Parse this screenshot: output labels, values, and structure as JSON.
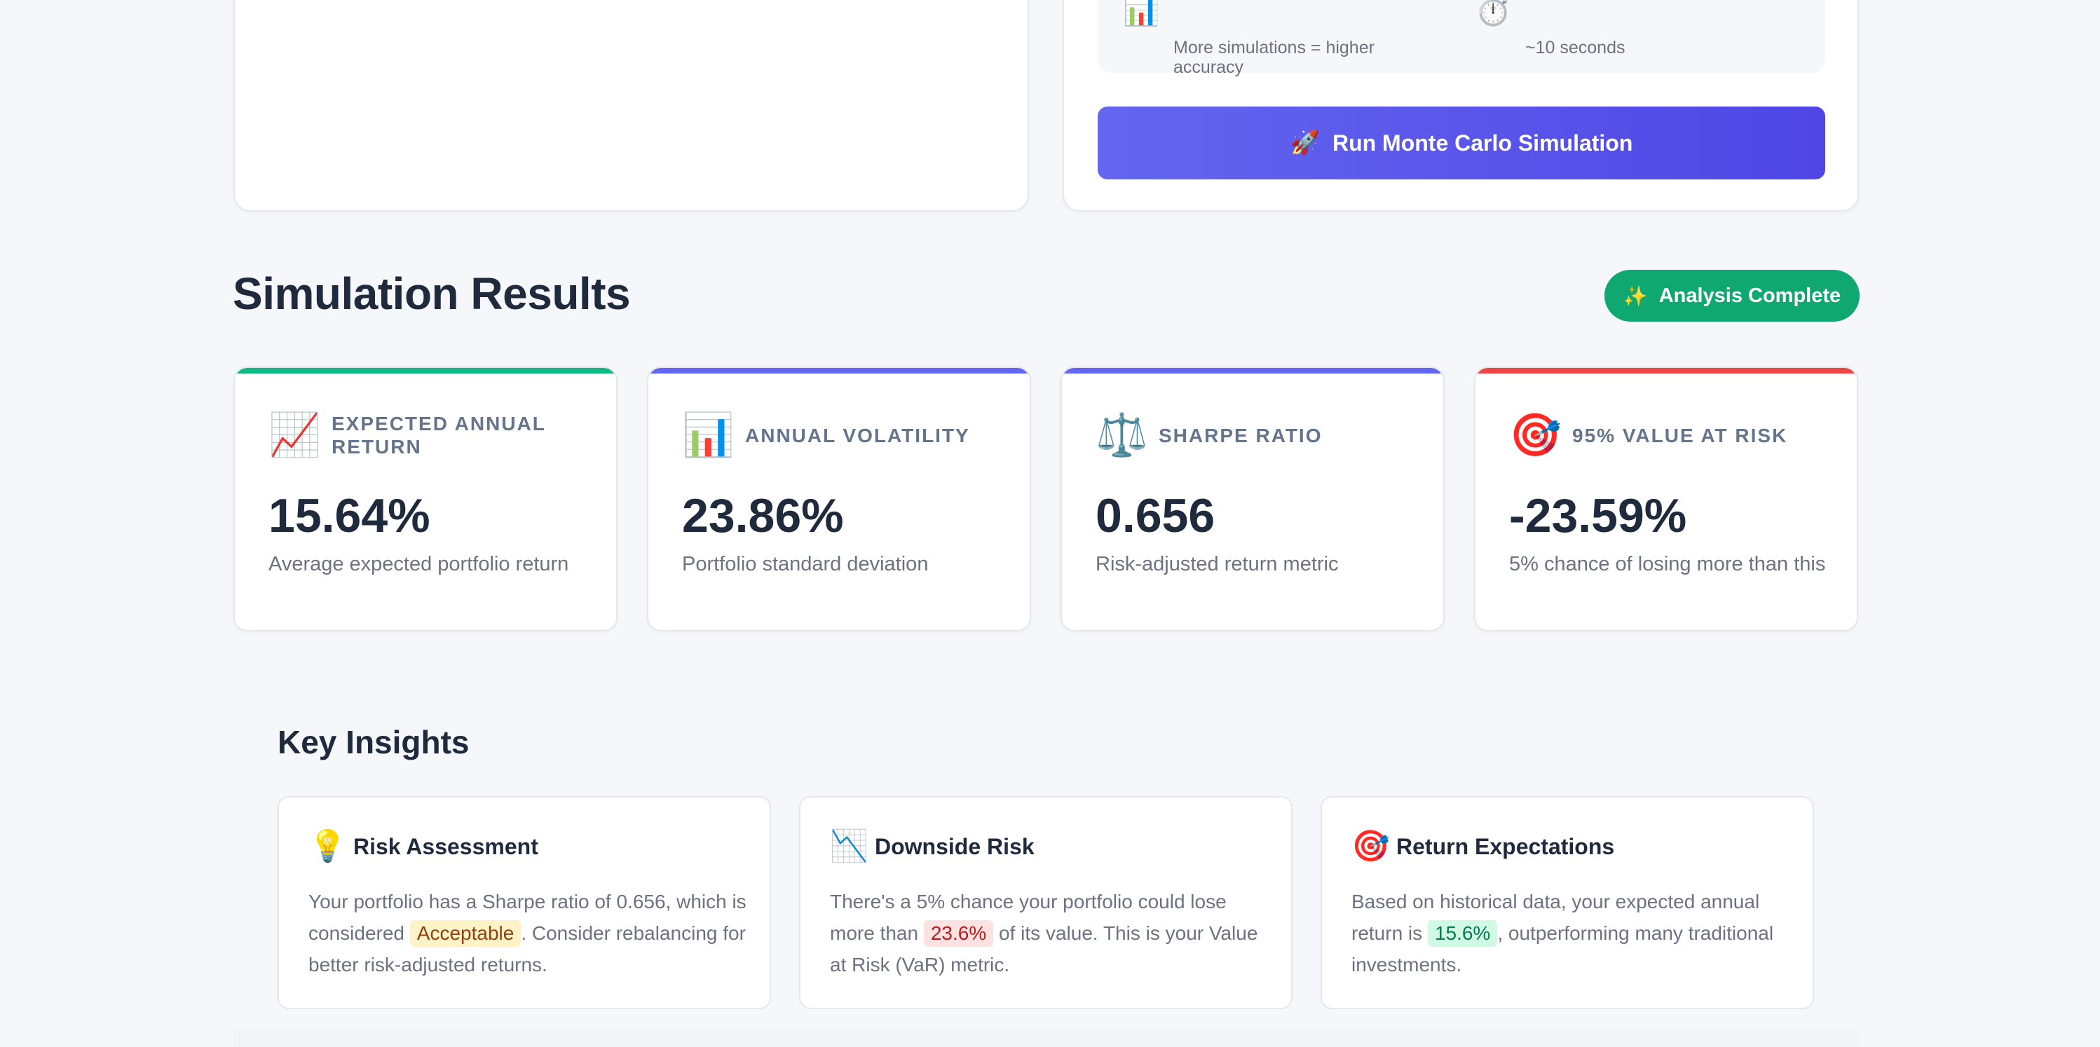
{
  "simulation_panel": {
    "info_items": [
      {
        "icon": "bar-chart-icon",
        "glyph": "📊",
        "description": "More simulations = higher accuracy"
      },
      {
        "icon": "stopwatch-icon",
        "glyph": "⏱️",
        "description": "~10 seconds"
      }
    ],
    "run_button": {
      "icon": "rocket-icon",
      "glyph": "🚀",
      "label": "Run Monte Carlo Simulation"
    }
  },
  "results": {
    "title": "Simulation Results",
    "status_badge": {
      "icon": "sparkles-icon",
      "glyph": "✨",
      "label": "Analysis Complete",
      "color": "#0fa870"
    }
  },
  "metrics": [
    {
      "icon": "chart-increasing-icon",
      "glyph": "📈",
      "label": "EXPECTED ANNUAL RETURN",
      "value": "15.64%",
      "description": "Average expected portfolio return",
      "accent": "#10b981"
    },
    {
      "icon": "bar-chart-icon",
      "glyph": "📊",
      "label": "ANNUAL VOLATILITY",
      "value": "23.86%",
      "description": "Portfolio standard deviation",
      "accent": "#6366f1"
    },
    {
      "icon": "balance-scale-icon",
      "glyph": "⚖️",
      "label": "SHARPE RATIO",
      "value": "0.656",
      "description": "Risk-adjusted return metric",
      "accent": "#6366f1"
    },
    {
      "icon": "target-icon",
      "glyph": "🎯",
      "label": "95% VALUE AT RISK",
      "value": "-23.59%",
      "description": "5% chance of losing more than this",
      "accent": "#ef4444"
    }
  ],
  "insights": {
    "title": "Key Insights",
    "cards": [
      {
        "icon": "lightbulb-icon",
        "glyph": "💡",
        "title": "Risk Assessment",
        "text_before": "Your portfolio has a Sharpe ratio of 0.656, which is considered ",
        "highlight": "Acceptable",
        "text_after": ". Consider rebalancing for better risk-adjusted returns."
      },
      {
        "icon": "chart-decreasing-icon",
        "glyph": "📉",
        "title": "Downside Risk",
        "text_before": "There's a 5% chance your portfolio could lose more than ",
        "highlight": "23.6%",
        "text_after": " of its value. This is your Value at Risk (VaR) metric."
      },
      {
        "icon": "target-icon",
        "glyph": "🎯",
        "title": "Return Expectations",
        "text_before": "Based on historical data, your expected annual return is ",
        "highlight": "15.6%",
        "text_after": ", outperforming many traditional investments."
      }
    ]
  }
}
